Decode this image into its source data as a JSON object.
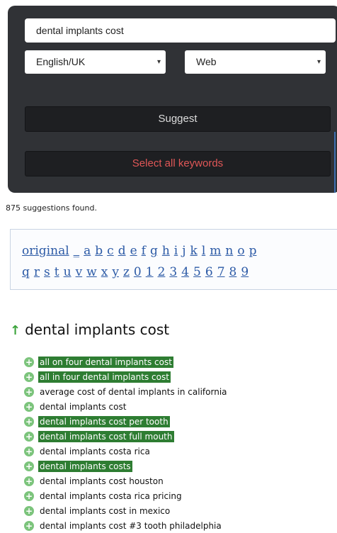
{
  "search": {
    "value": "dental implants cost"
  },
  "language": {
    "selected": "English/UK"
  },
  "source": {
    "selected": "Web"
  },
  "buttons": {
    "suggest": "Suggest",
    "select_all": "Select all keywords"
  },
  "colors": {
    "select_all_text": "#e05757",
    "selected_bg": "#2e7d32",
    "link": "#2c5aa6"
  },
  "results": {
    "count_text": "875 suggestions found."
  },
  "alphabet": {
    "row1": [
      "original",
      "_",
      "a",
      "b",
      "c",
      "d",
      "e",
      "f",
      "g",
      "h",
      "i",
      "j",
      "k",
      "l",
      "m",
      "n",
      "o",
      "p"
    ],
    "row2": [
      "q",
      "r",
      "s",
      "t",
      "u",
      "v",
      "w",
      "x",
      "y",
      "z",
      "0",
      "1",
      "2",
      "3",
      "4",
      "5",
      "6",
      "7",
      "8",
      "9"
    ]
  },
  "group": {
    "title": "dental implants cost",
    "icon": "up-arrow-icon"
  },
  "keywords": [
    {
      "text": "all on four dental implants cost",
      "selected": true
    },
    {
      "text": "all in four dental implants cost",
      "selected": true
    },
    {
      "text": "average cost of dental implants in california",
      "selected": false
    },
    {
      "text": "dental implants cost",
      "selected": false
    },
    {
      "text": "dental implants cost per tooth",
      "selected": true
    },
    {
      "text": "dental implants cost full mouth",
      "selected": true
    },
    {
      "text": "dental implants costa rica",
      "selected": false
    },
    {
      "text": "dental implants costs",
      "selected": true
    },
    {
      "text": "dental implants cost houston",
      "selected": false
    },
    {
      "text": "dental implants costa rica pricing",
      "selected": false
    },
    {
      "text": "dental implants cost in mexico",
      "selected": false
    },
    {
      "text": "dental implants cost #3 tooth philadelphia",
      "selected": false
    }
  ]
}
